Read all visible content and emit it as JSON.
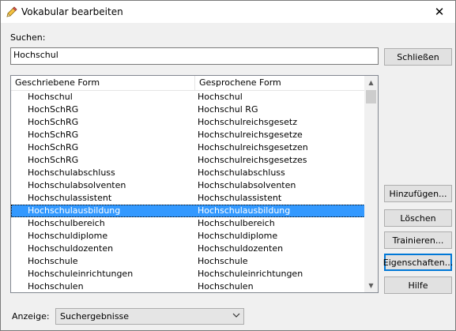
{
  "window": {
    "title": "Vokabular bearbeiten",
    "close_glyph": "✕"
  },
  "search": {
    "label": "Suchen:",
    "value": "Hochschul"
  },
  "buttons": {
    "close": "Schließen",
    "add": "Hinzufügen...",
    "delete": "Löschen",
    "train": "Trainieren...",
    "properties": "Eigenschaften...",
    "help": "Hilfe"
  },
  "list": {
    "headers": [
      "Geschriebene Form",
      "Gesprochene Form"
    ],
    "rows": [
      [
        "Hochschul",
        "Hochschul"
      ],
      [
        "HochSchRG",
        "Hochschul RG"
      ],
      [
        "HochSchRG",
        "Hochschulreichsgesetz"
      ],
      [
        "HochSchRG",
        "Hochschulreichsgesetze"
      ],
      [
        "HochSchRG",
        "Hochschulreichsgesetzen"
      ],
      [
        "HochSchRG",
        "Hochschulreichsgesetzes"
      ],
      [
        "Hochschulabschluss",
        "Hochschulabschluss"
      ],
      [
        "Hochschulabsolventen",
        "Hochschulabsolventen"
      ],
      [
        "Hochschulassistent",
        "Hochschulassistent"
      ],
      [
        "Hochschulausbildung",
        "Hochschulausbildung"
      ],
      [
        "Hochschulbereich",
        "Hochschulbereich"
      ],
      [
        "Hochschuldiplome",
        "Hochschuldiplome"
      ],
      [
        "Hochschuldozenten",
        "Hochschuldozenten"
      ],
      [
        "Hochschule",
        "Hochschule"
      ],
      [
        "Hochschuleinrichtungen",
        "Hochschuleinrichtungen"
      ],
      [
        "Hochschulen",
        "Hochschulen"
      ]
    ],
    "selected_row": "Hochschulausbildung"
  },
  "display": {
    "label": "Anzeige:",
    "value": "Suchergebnisse"
  },
  "icons": {
    "title": "pencil-icon",
    "close": "close-icon",
    "scroll_up": "chevron-up-icon",
    "scroll_down": "chevron-down-icon",
    "dropdown": "chevron-down-icon"
  }
}
